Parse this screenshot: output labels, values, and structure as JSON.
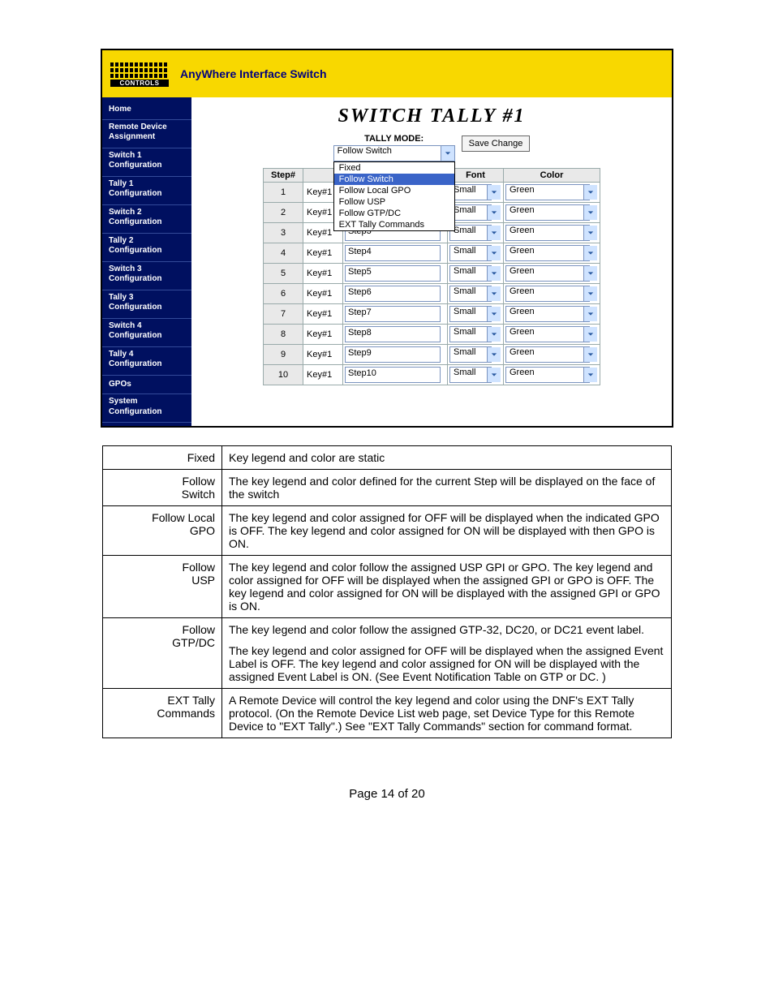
{
  "header": {
    "logo_caption": "CONTROLS",
    "app_title": "AnyWhere Interface Switch"
  },
  "sidebar": {
    "items": [
      "Home",
      "Remote Device Assignment",
      "Switch 1 Configuration",
      "Tally 1 Configuration",
      "Switch 2 Configuration",
      "Tally 2 Configuration",
      "Switch 3 Configuration",
      "Tally 3 Configuration",
      "Switch 4 Configuration",
      "Tally 4 Configuration",
      "GPOs",
      "System Configuration"
    ]
  },
  "main": {
    "title": "SWITCH TALLY #1",
    "mode_label": "TALLY MODE:",
    "mode_selected": "Follow Switch",
    "mode_options": [
      "Fixed",
      "Follow Switch",
      "Follow Local GPO",
      "Follow USP",
      "Follow GTP/DC",
      "EXT Tally Commands"
    ],
    "save_label": "Save Change",
    "columns": {
      "step": "Step#",
      "blank": "",
      "legend": "",
      "font": "Font",
      "color": "Color"
    },
    "key_label": "Key#1",
    "font_value": "Small",
    "color_value": "Green",
    "rows": [
      {
        "n": "1",
        "legend": ""
      },
      {
        "n": "2",
        "legend": ""
      },
      {
        "n": "3",
        "legend": "Step3"
      },
      {
        "n": "4",
        "legend": "Step4"
      },
      {
        "n": "5",
        "legend": "Step5"
      },
      {
        "n": "6",
        "legend": "Step6"
      },
      {
        "n": "7",
        "legend": "Step7"
      },
      {
        "n": "8",
        "legend": "Step8"
      },
      {
        "n": "9",
        "legend": "Step9"
      },
      {
        "n": "10",
        "legend": "Step10"
      }
    ]
  },
  "desc": [
    {
      "term": "Fixed",
      "text": "Key legend and color are static"
    },
    {
      "term": "Follow Switch",
      "text": "The key legend and color defined for the current Step will be displayed on the face of the switch"
    },
    {
      "term": "Follow Local GPO",
      "text": "The key legend and color assigned for OFF will be displayed when the indicated GPO is OFF.  The key legend and color assigned for ON will be displayed with then GPO is ON."
    },
    {
      "term": "Follow USP",
      "text": "The key legend and color follow the assigned USP GPI or GPO.  The key legend and color assigned for OFF will be displayed when the assigned GPI or GPO is OFF.  The key legend and color assigned for ON will be displayed with the assigned GPI or GPO is ON."
    },
    {
      "term": "Follow GTP/DC",
      "text": "The key legend and color follow the assigned GTP-32, DC20, or DC21 event label.",
      "text2": "The key legend and color assigned for OFF will be displayed when the assigned Event Label is OFF.  The key legend and color assigned for ON will be displayed with the assigned Event Label is ON. (See Event Notification Table on GTP or DC. )"
    },
    {
      "term": "EXT Tally Commands",
      "text": "A Remote Device will control the key legend and color using the DNF's EXT Tally protocol.  (On the Remote Device List web page, set Device Type for this Remote Device to \"EXT Tally\".)  See \"EXT Tally Commands\" section for command format."
    }
  ],
  "footer": "Page 14 of 20"
}
